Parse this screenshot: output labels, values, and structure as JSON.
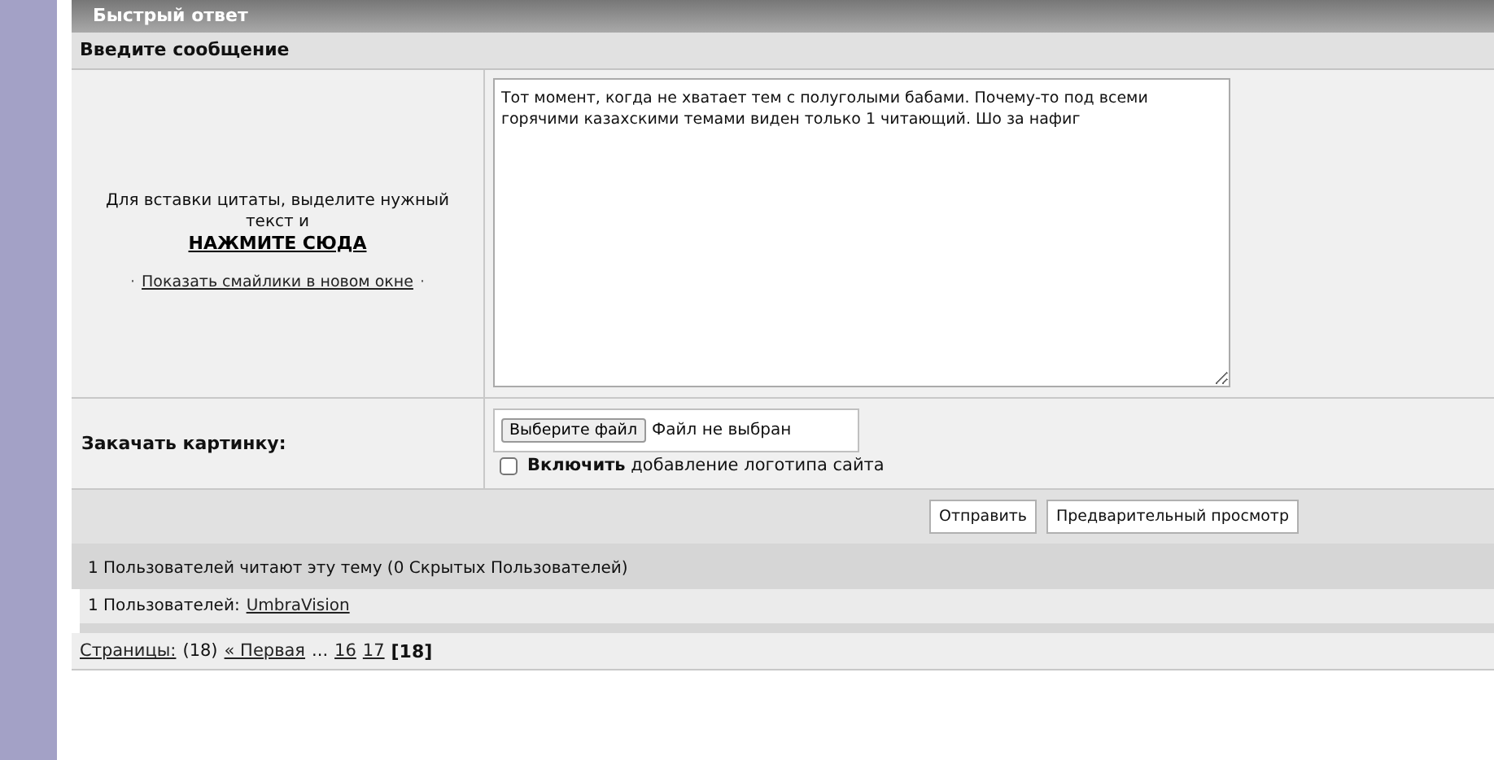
{
  "header": {
    "title": "Быстрый ответ"
  },
  "message_section": {
    "title": "Введите сообщение"
  },
  "quote_hint": {
    "text": "Для вставки цитаты, выделите нужный текст и",
    "link": "НАЖМИТЕ СЮДА"
  },
  "smilies": {
    "before": "·",
    "link": "Показать смайлики в новом окне",
    "after": "·"
  },
  "message": {
    "value": "Тот момент, когда не хватает тем с полуголыми бабами. Почему-то под всеми горячими казахскими темами виден только 1 читающий. Шо за нафиг"
  },
  "upload": {
    "label": "Закачать картинку:",
    "button": "Выберите файл",
    "status": "Файл не выбран"
  },
  "logo_option": {
    "label": "**Включить** добавление логотипа сайта",
    "checked": false
  },
  "buttons": [
    "Отправить",
    "Предварительный просмотр"
  ],
  "readers": {
    "title": "1 Пользователей читают эту тему (0 Скрытых Пользователей)",
    "label": "1 Пользователей:",
    "users": [
      "UmbraVision"
    ]
  },
  "pagination": [
    {
      "kind": "link",
      "text": "Страницы:"
    },
    {
      "kind": "text",
      "text": "(18)"
    },
    {
      "kind": "link",
      "text": "« Первая"
    },
    {
      "kind": "text",
      "text": "..."
    },
    {
      "kind": "link",
      "text": "16"
    },
    {
      "kind": "link",
      "text": "17"
    },
    {
      "kind": "current",
      "text": "[18]"
    }
  ]
}
